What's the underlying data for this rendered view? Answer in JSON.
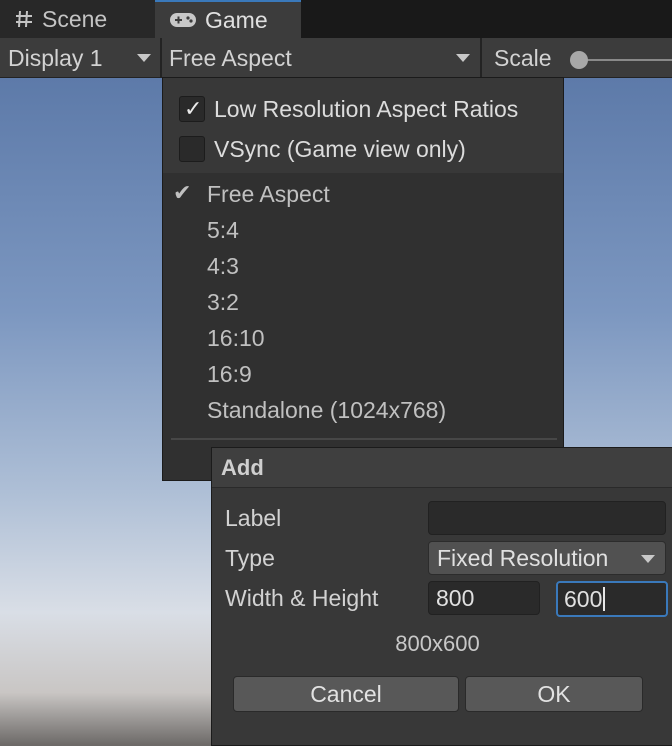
{
  "tabs": [
    {
      "label": "Scene",
      "icon": "hash-icon"
    },
    {
      "label": "Game",
      "icon": "gamepad-icon"
    }
  ],
  "toolbar": {
    "display": "Display 1",
    "aspect": "Free Aspect",
    "scale_label": "Scale"
  },
  "dropdown": {
    "low_res": {
      "label": "Low Resolution Aspect Ratios",
      "checked": true
    },
    "vsync": {
      "label": "VSync (Game view only)",
      "checked": false
    },
    "options": [
      "Free Aspect",
      "5:4",
      "4:3",
      "3:2",
      "16:10",
      "16:9",
      "Standalone (1024x768)"
    ],
    "selected": "Free Aspect",
    "check_glyph": "✓",
    "check_glyph_small": "✔"
  },
  "add_dialog": {
    "title": "Add",
    "label_label": "Label",
    "label_value": "",
    "type_label": "Type",
    "type_value": "Fixed Resolution",
    "wh_label": "Width & Height",
    "width": "800",
    "height": "600",
    "result": "800x600",
    "cancel": "Cancel",
    "ok": "OK"
  },
  "colors": {
    "accent": "#3a79bb",
    "panel": "#383838",
    "toolbar": "#3c3c3c"
  }
}
